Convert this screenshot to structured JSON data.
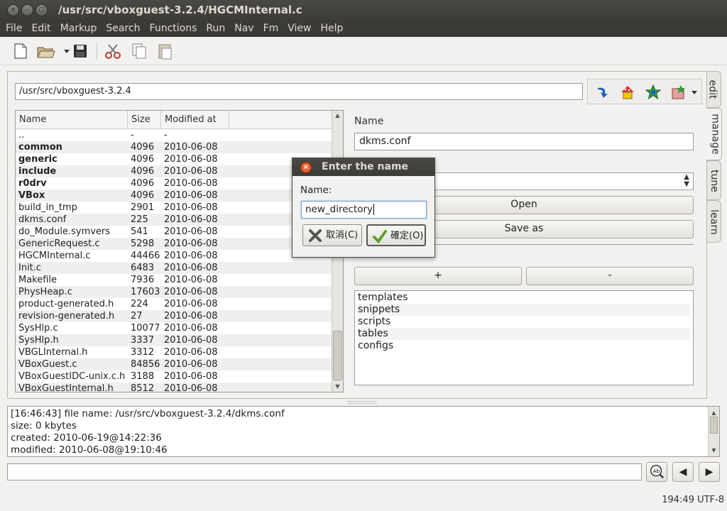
{
  "window": {
    "title": "/usr/src/vboxguest-3.2.4/HGCMInternal.c",
    "controls": [
      "×",
      "–",
      "□"
    ]
  },
  "menubar": [
    "File",
    "Edit",
    "Markup",
    "Search",
    "Functions",
    "Run",
    "Nav",
    "Fm",
    "View",
    "Help"
  ],
  "toolbar": {
    "icons": [
      "new-file-icon",
      "open-folder-icon",
      "dropdown-arrow-icon",
      "save-icon",
      "cut-icon",
      "copy-icon",
      "paste-icon"
    ]
  },
  "path": "/usr/src/vboxguest-3.2.4",
  "file_list": {
    "columns": [
      "Name",
      "Size",
      "Modified at"
    ],
    "rows": [
      {
        "name": "..",
        "size": "-",
        "modified": "-",
        "dir": false
      },
      {
        "name": "common",
        "size": "4096",
        "modified": "2010-06-08",
        "dir": true
      },
      {
        "name": "generic",
        "size": "4096",
        "modified": "2010-06-08",
        "dir": true
      },
      {
        "name": "include",
        "size": "4096",
        "modified": "2010-06-08",
        "dir": true
      },
      {
        "name": "r0drv",
        "size": "4096",
        "modified": "2010-06-08",
        "dir": true
      },
      {
        "name": "VBox",
        "size": "4096",
        "modified": "2010-06-08",
        "dir": true
      },
      {
        "name": "build_in_tmp",
        "size": "2901",
        "modified": "2010-06-08",
        "dir": false
      },
      {
        "name": "dkms.conf",
        "size": "225",
        "modified": "2010-06-08",
        "dir": false
      },
      {
        "name": "do_Module.symvers",
        "size": "541",
        "modified": "2010-06-08",
        "dir": false
      },
      {
        "name": "GenericRequest.c",
        "size": "5298",
        "modified": "2010-06-08",
        "dir": false
      },
      {
        "name": "HGCMInternal.c",
        "size": "44466",
        "modified": "2010-06-08",
        "dir": false
      },
      {
        "name": "Init.c",
        "size": "6483",
        "modified": "2010-06-08",
        "dir": false
      },
      {
        "name": "Makefile",
        "size": "7936",
        "modified": "2010-06-08",
        "dir": false
      },
      {
        "name": "PhysHeap.c",
        "size": "17603",
        "modified": "2010-06-08",
        "dir": false
      },
      {
        "name": "product-generated.h",
        "size": "224",
        "modified": "2010-06-08",
        "dir": false
      },
      {
        "name": "revision-generated.h",
        "size": "27",
        "modified": "2010-06-08",
        "dir": false
      },
      {
        "name": "SysHlp.c",
        "size": "10077",
        "modified": "2010-06-08",
        "dir": false
      },
      {
        "name": "SysHlp.h",
        "size": "3337",
        "modified": "2010-06-08",
        "dir": false
      },
      {
        "name": "VBGLInternal.h",
        "size": "3312",
        "modified": "2010-06-08",
        "dir": false
      },
      {
        "name": "VBoxGuest.c",
        "size": "84856",
        "modified": "2010-06-08",
        "dir": false
      },
      {
        "name": "VBoxGuestIDC-unix.c.h",
        "size": "3188",
        "modified": "2010-06-08",
        "dir": false
      },
      {
        "name": "VBoxGuestInternal.h",
        "size": "8512",
        "modified": "2010-06-08",
        "dir": false
      }
    ]
  },
  "right_panel": {
    "name_label": "Name",
    "name_value": "dkms.conf",
    "open_button": "Open",
    "save_as_button": "Save as",
    "add_button": "+",
    "remove_button": "-",
    "bookmarks": [
      "templates",
      "snippets",
      "scripts",
      "tables",
      "configs"
    ]
  },
  "side_tabs": [
    "edit",
    "manage",
    "tune",
    "learn"
  ],
  "log": [
    "[16:46:43] file name: /usr/src/vboxguest-3.2.4/dkms.conf",
    "size: 0 kbytes",
    "created: 2010-06-19@14:22:36",
    "modified: 2010-06-08@19:10:46"
  ],
  "status_bar": "194:49 UTF-8",
  "dialog": {
    "title": "Enter the name",
    "label": "Name:",
    "value": "new_directory",
    "cancel": "取消(C)",
    "ok": "確定(O)"
  }
}
